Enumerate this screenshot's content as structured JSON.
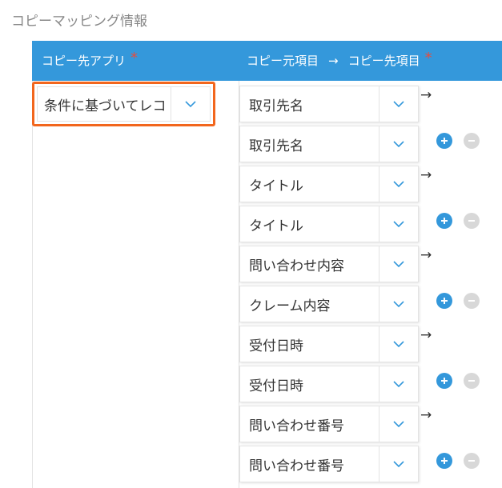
{
  "section": {
    "title": "コピーマッピング情報"
  },
  "header": {
    "dest_app_label": "コピー先アプリ",
    "mapping_label_source": "コピー元項目",
    "mapping_arrow": "→",
    "mapping_label_dest": "コピー先項目",
    "required_mark": "*"
  },
  "app_select": {
    "value": "条件に基づいてレコー"
  },
  "mappings": [
    {
      "source": "取引先名",
      "dest": "取引先名"
    },
    {
      "source": "タイトル",
      "dest": "タイトル"
    },
    {
      "source": "問い合わせ内容",
      "dest": "クレーム内容"
    },
    {
      "source": "受付日時",
      "dest": "受付日時"
    },
    {
      "source": "問い合わせ番号",
      "dest": "問い合わせ番号"
    }
  ],
  "row_arrow": "→",
  "colors": {
    "header_bg": "#3498db",
    "required": "#e74c3c",
    "highlight_border": "#f2661d",
    "add_button": "#3498db",
    "remove_button": "#d8d8d8"
  },
  "icons": {
    "dropdown": "chevron-down-icon",
    "add": "plus-icon",
    "remove": "minus-icon"
  }
}
